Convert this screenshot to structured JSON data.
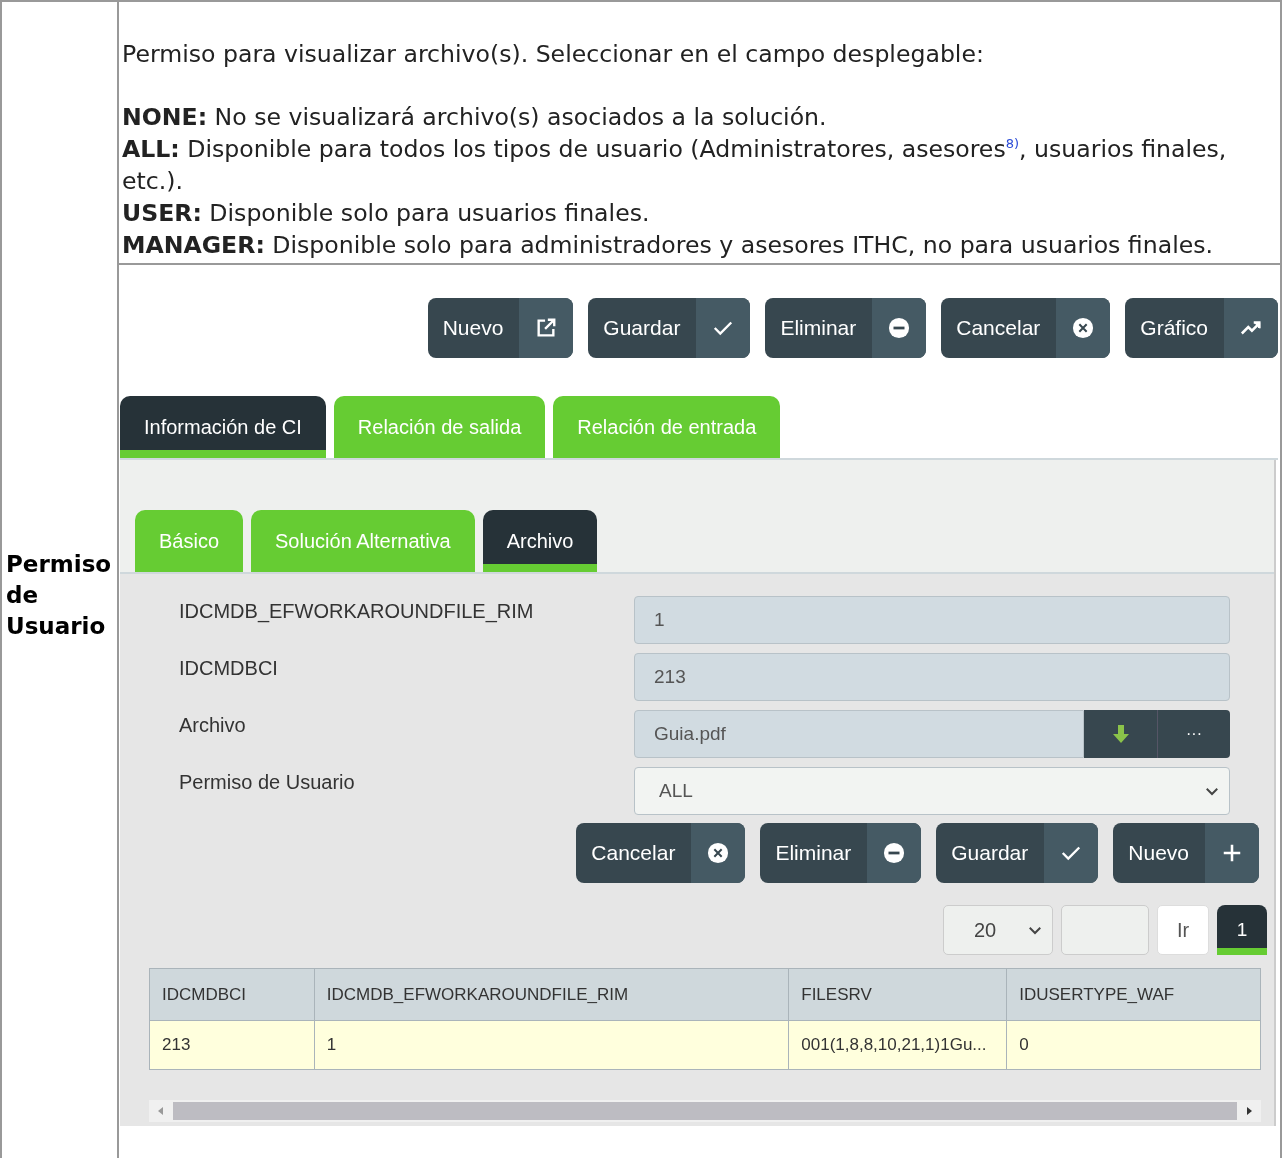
{
  "row_header": "Permiso de Usuario",
  "description": {
    "intro": "Permiso para visualizar archivo(s). Seleccionar en el campo desplegable:",
    "options": [
      {
        "term": "NONE:",
        "text": "No se visualizará archivo(s) asociados a la solución."
      },
      {
        "term": "ALL:",
        "text": "Disponible para todos los tipos de usuario (Administratores, asesores",
        "footnote": "8)",
        "text_after": ", usuarios finales, etc.)."
      },
      {
        "term": "USER:",
        "text": "Disponible solo para usuarios finales."
      },
      {
        "term": "MANAGER:",
        "text": "Disponible solo para administradores y asesores ITHC, no para usuarios finales."
      }
    ]
  },
  "screenshot": {
    "toolbar": [
      {
        "label": "Nuevo",
        "kind": "external"
      },
      {
        "label": "Guardar",
        "kind": "check"
      },
      {
        "label": "Eliminar",
        "kind": "minus"
      },
      {
        "label": "Cancelar",
        "kind": "cross"
      },
      {
        "label": "Gráfico",
        "kind": "trend"
      }
    ],
    "main_tabs": [
      {
        "label": "Información de CI",
        "selected": true
      },
      {
        "label": "Relación de salida",
        "selected": false
      },
      {
        "label": "Relación de entrada",
        "selected": false
      }
    ],
    "sub_tabs": [
      {
        "label": "Básico",
        "selected": false
      },
      {
        "label": "Solución Alternativa",
        "selected": false
      },
      {
        "label": "Archivo",
        "selected": true
      }
    ],
    "fields": [
      {
        "label": "IDCMDB_EFWORKAROUNDFILE_RIM",
        "kind": "text",
        "value": "1"
      },
      {
        "label": "IDCMDBCI",
        "kind": "text",
        "value": "213"
      },
      {
        "label": "Archivo",
        "kind": "file",
        "value": "Guia.pdf",
        "more_label": "···"
      },
      {
        "label": "Permiso de Usuario",
        "kind": "select",
        "value": "ALL"
      }
    ],
    "form_buttons": [
      {
        "label": "Cancelar",
        "kind": "cross"
      },
      {
        "label": "Eliminar",
        "kind": "minus"
      },
      {
        "label": "Guardar",
        "kind": "check"
      },
      {
        "label": "Nuevo",
        "kind": "plus"
      }
    ],
    "pagination": {
      "page_size": "20",
      "go_label": "Ir",
      "pages": [
        {
          "label": "1",
          "selected": true
        }
      ]
    },
    "table": {
      "columns": [
        "IDCMDBCI",
        "IDCMDB_EFWORKAROUNDFILE_RIM",
        "FILESRV",
        "IDUSERTYPE_WAF"
      ],
      "rows": [
        {
          "cells": [
            "213",
            "1",
            "001(1,8,8,10,21,1)1Gu...",
            "0"
          ],
          "selected": true
        }
      ]
    }
  }
}
